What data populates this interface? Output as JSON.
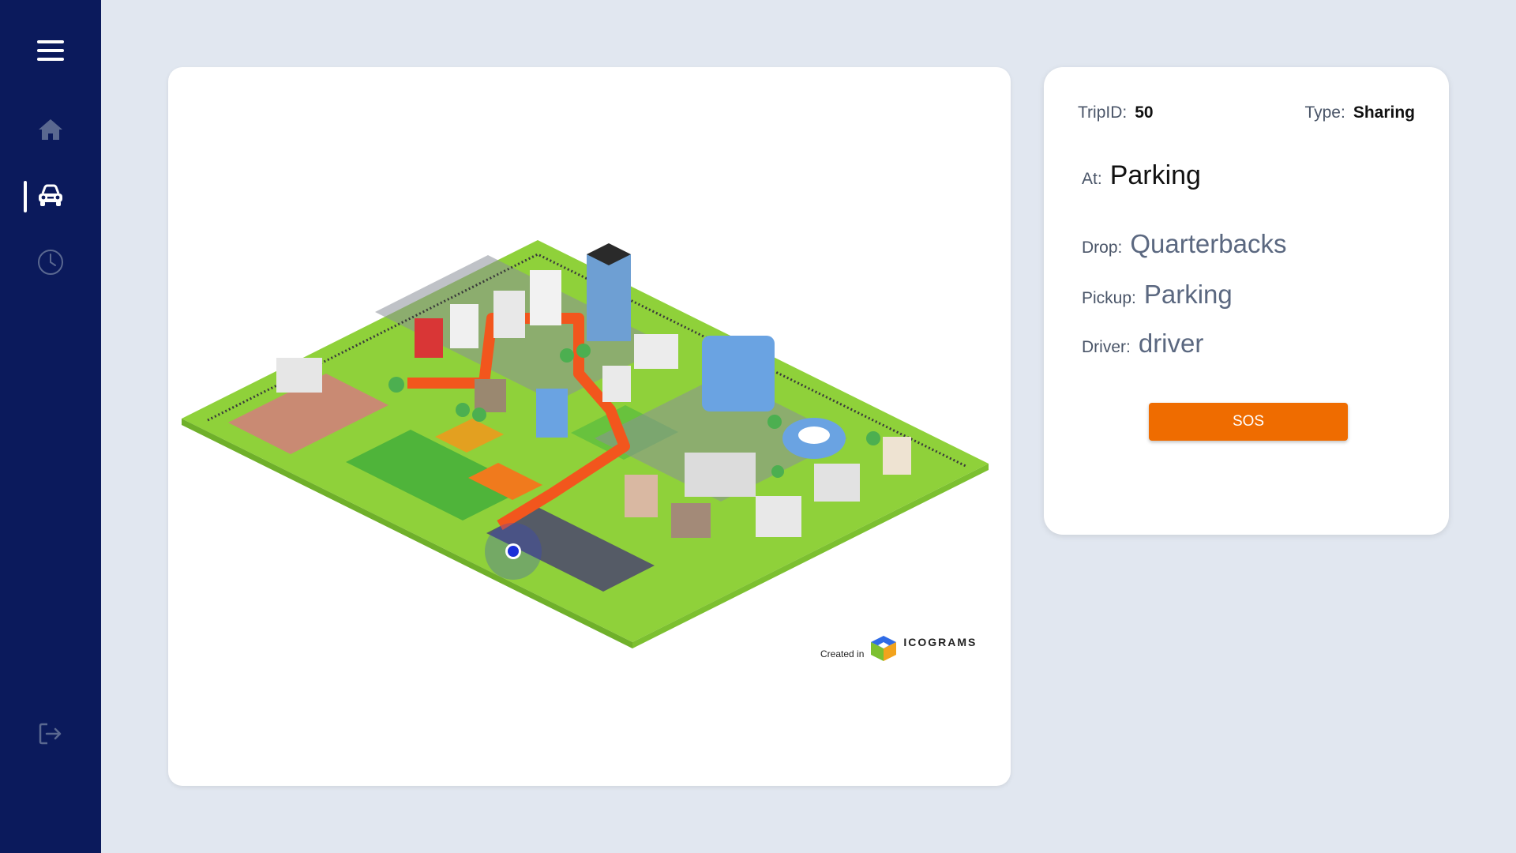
{
  "sidebar": {
    "items": [
      {
        "name": "menu-icon"
      },
      {
        "name": "home-icon"
      },
      {
        "name": "taxi-icon",
        "active": true
      },
      {
        "name": "history-icon"
      },
      {
        "name": "logout-icon"
      }
    ]
  },
  "map": {
    "watermark_created": "Created in",
    "watermark_brand": "ICOGRAMS",
    "vehicle_marker_color": "#1a2fd8"
  },
  "trip": {
    "trip_id_label": "TripID:",
    "trip_id": "50",
    "type_label": "Type:",
    "type": "Sharing",
    "at_label": "At:",
    "at": "Parking",
    "drop_label": "Drop:",
    "drop": "Quarterbacks",
    "pickup_label": "Pickup:",
    "pickup": "Parking",
    "driver_label": "Driver:",
    "driver": "driver"
  },
  "actions": {
    "sos_label": "SOS",
    "sos_color": "#ef6c00"
  },
  "colors": {
    "sidebar": "#0b1a5c",
    "background": "#e1e7f0",
    "grass": "#8fd13a",
    "road": "#f2561d"
  }
}
